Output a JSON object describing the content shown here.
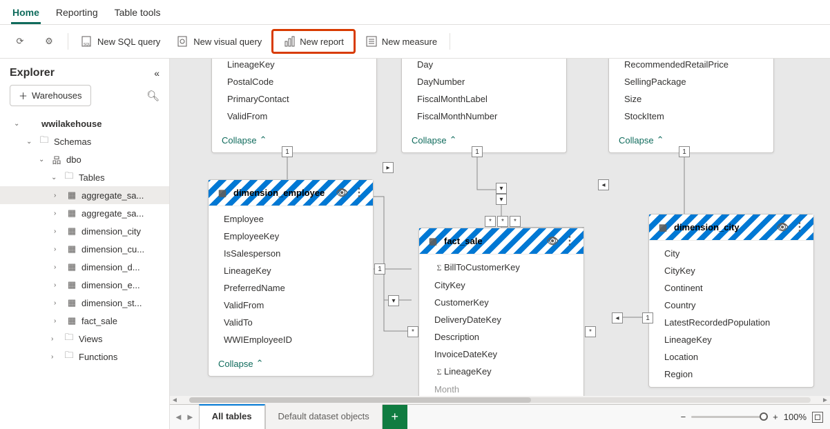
{
  "tabs": {
    "home": "Home",
    "reporting": "Reporting",
    "tableTools": "Table tools"
  },
  "toolbar": {
    "newSqlQuery": "New SQL query",
    "newVisualQuery": "New visual query",
    "newReport": "New report",
    "newMeasure": "New measure"
  },
  "explorer": {
    "title": "Explorer",
    "warehousesPill": "Warehouses",
    "tree": {
      "root": "wwilakehouse",
      "schemas": "Schemas",
      "dbo": "dbo",
      "tables": "Tables",
      "tableItems": [
        "aggregate_sa...",
        "aggregate_sa...",
        "dimension_city",
        "dimension_cu...",
        "dimension_d...",
        "dimension_e...",
        "dimension_st...",
        "fact_sale"
      ],
      "views": "Views",
      "functions": "Functions"
    }
  },
  "canvas": {
    "collapse": "Collapse",
    "cardTopLeft": {
      "cols": [
        "LineageKey",
        "PostalCode",
        "PrimaryContact",
        "ValidFrom"
      ]
    },
    "cardTopMid": {
      "cols": [
        "Day",
        "DayNumber",
        "FiscalMonthLabel",
        "FiscalMonthNumber"
      ]
    },
    "cardTopRight": {
      "cols": [
        "RecommendedRetailPrice",
        "SellingPackage",
        "Size",
        "StockItem"
      ]
    },
    "dimEmployee": {
      "title": "dimension_employee",
      "cols": [
        "Employee",
        "EmployeeKey",
        "IsSalesperson",
        "LineageKey",
        "PreferredName",
        "ValidFrom",
        "ValidTo",
        "WWIEmployeeID"
      ]
    },
    "factSale": {
      "title": "fact_sale",
      "cols": [
        "BillToCustomerKey",
        "CityKey",
        "CustomerKey",
        "DeliveryDateKey",
        "Description",
        "InvoiceDateKey",
        "LineageKey",
        "Month"
      ]
    },
    "dimCity": {
      "title": "dimension_city",
      "cols": [
        "City",
        "CityKey",
        "Continent",
        "Country",
        "LatestRecordedPopulation",
        "LineageKey",
        "Location",
        "Region"
      ]
    }
  },
  "bottomBar": {
    "allTables": "All tables",
    "defaultDataset": "Default dataset objects",
    "zoom": "100%"
  }
}
